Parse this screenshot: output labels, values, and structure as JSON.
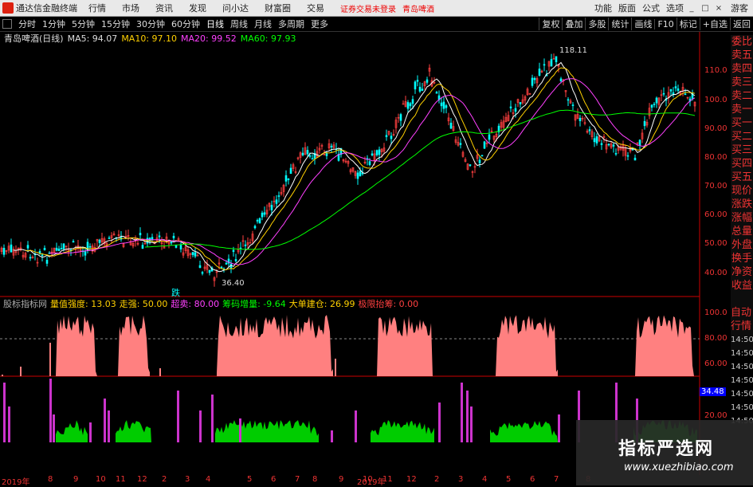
{
  "window": {
    "app_title": "通达信金融终端",
    "menus": [
      "行情",
      "市场",
      "资讯",
      "发现",
      "问小达",
      "财富圈",
      "交易"
    ],
    "warning": "证券交易未登录",
    "stock_tag": "青岛啤酒",
    "right_menus": [
      "功能",
      "版面",
      "公式",
      "选项"
    ],
    "guest": "游客"
  },
  "timeframes": [
    "分时",
    "1分钟",
    "5分钟",
    "15分钟",
    "30分钟",
    "60分钟",
    "日线",
    "周线",
    "月线",
    "多周期",
    "更多"
  ],
  "active_timeframe": "日线",
  "right_tools": [
    "复权",
    "叠加",
    "多股",
    "统计",
    "画线",
    "F10",
    "标记",
    "+自选",
    "返回"
  ],
  "ma_header": {
    "name": "青岛啤酒(日线)",
    "ma5": "MA5: 94.07",
    "ma10": "MA10: 97.10",
    "ma20": "MA20: 99.52",
    "ma60": "MA60: 97.93"
  },
  "price_axis": [
    "110.0",
    "100.0",
    "90.00",
    "80.00",
    "70.00",
    "60.00",
    "50.00",
    "40.00"
  ],
  "annotations": {
    "high": "118.11",
    "low": "36.40",
    "marker": "跌"
  },
  "indicator_header": {
    "name": "股标指标网",
    "a": "量值强度: 13.03",
    "b": "走强: 50.00",
    "c": "超卖: 80.00",
    "d": "筹码增量: -9.64",
    "e": "大单建仓: 26.99",
    "f": "极限抬筹: 0.00"
  },
  "ind_axis": [
    "100.0",
    "80.00",
    "60.00"
  ],
  "vol_axis": [
    "34.48",
    "20.00"
  ],
  "right_side_tabs": [
    "委比",
    "卖五",
    "卖四",
    "卖三",
    "卖二",
    "卖一",
    "买一",
    "买二",
    "买三",
    "买四",
    "买五",
    "现价",
    "涨跌",
    "涨幅",
    "总量",
    "外盘",
    "换手",
    "净资",
    "收益"
  ],
  "right_side_tabs2": [
    "自动",
    "行情",
    "14:50",
    "14:50",
    "14:50",
    "14:50",
    "14:50",
    "14:50",
    "14:50"
  ],
  "x_axis": [
    "2019年",
    "8",
    "9",
    "10",
    "11",
    "12",
    "2",
    "3",
    "4",
    "5",
    "6",
    "7",
    "8",
    "9",
    "10",
    "2019年",
    "11",
    "12",
    "2",
    "3",
    "4",
    "5",
    "6",
    "7",
    "8"
  ],
  "watermark": {
    "title": "指标严选网",
    "url": "www.xuezhibiao.com"
  },
  "colors": {
    "up": "#ff4040",
    "down": "#00ffff",
    "ma5": "#ffffff",
    "ma10": "#ffd000",
    "ma20": "#ff40ff",
    "ma60": "#00ff00",
    "indicator": "#ff8080",
    "vol_green": "#00cc00",
    "vol_purple": "#cc33cc"
  }
}
